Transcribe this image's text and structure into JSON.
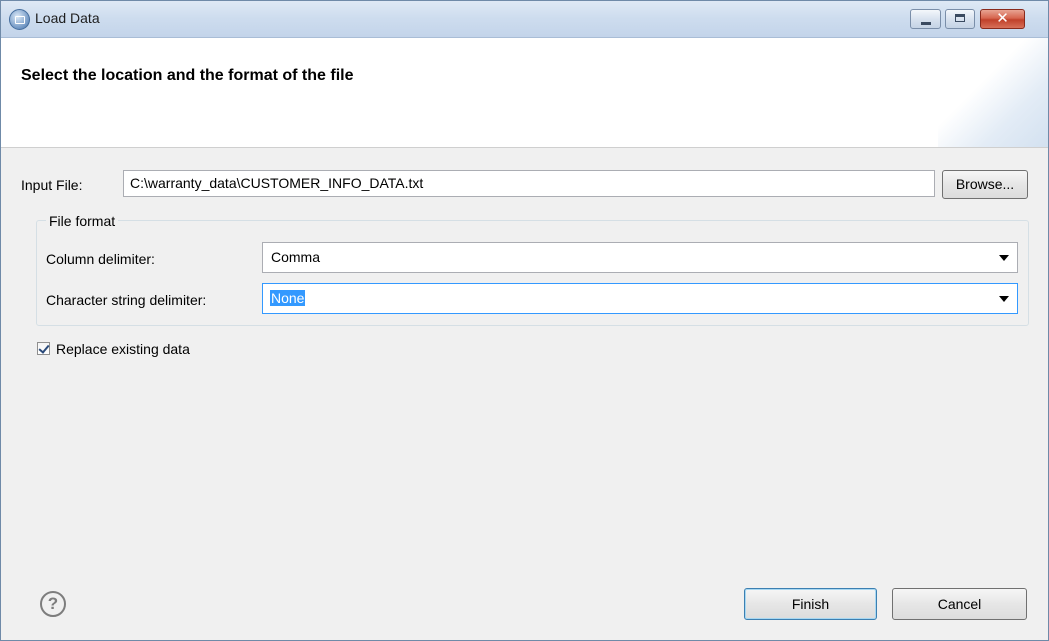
{
  "window": {
    "title": "Load Data",
    "close_glyph": "✕"
  },
  "banner": {
    "title": "Select the location and the format of the file"
  },
  "input_file": {
    "label": "Input File:",
    "value": "C:\\warranty_data\\CUSTOMER_INFO_DATA.txt",
    "browse_label": "Browse..."
  },
  "file_format": {
    "group_label": "File format",
    "column_delimiter": {
      "label": "Column delimiter:",
      "value": "Comma"
    },
    "string_delimiter": {
      "label": "Character string delimiter:",
      "value": "None"
    }
  },
  "replace": {
    "label": "Replace existing data",
    "checked": true
  },
  "footer": {
    "help_glyph": "?",
    "finish_label": "Finish",
    "cancel_label": "Cancel"
  },
  "colors": {
    "accent": "#3399ff",
    "dialog_bg": "#f0f0f0",
    "close_button": "#c0402a"
  },
  "icons": [
    "app-icon",
    "minimize-icon",
    "maximize-icon",
    "close-icon",
    "dropdown-arrow-icon",
    "help-icon",
    "checkmark-icon"
  ]
}
